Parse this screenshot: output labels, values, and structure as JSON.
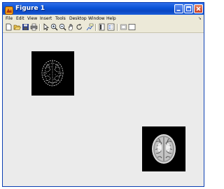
{
  "window": {
    "title": "Figure 1"
  },
  "menus": [
    "File",
    "Edit",
    "View",
    "Insert",
    "Tools",
    "Desktop",
    "Window",
    "Help"
  ],
  "toolbar": {
    "tools": [
      "new-figure-icon",
      "open-file-icon",
      "save-icon",
      "print-icon",
      "edit-plot-arrow-icon",
      "zoom-in-icon",
      "zoom-out-icon",
      "pan-hand-icon",
      "rotate-3d-icon",
      "data-cursor-icon",
      "colorbar-icon",
      "legend-icon",
      "hide-plot-tools-icon",
      "show-plot-tools-icon"
    ]
  },
  "images": [
    {
      "name": "edge-detected-brain-slice"
    },
    {
      "name": "brain-mri-axial-slice"
    }
  ]
}
